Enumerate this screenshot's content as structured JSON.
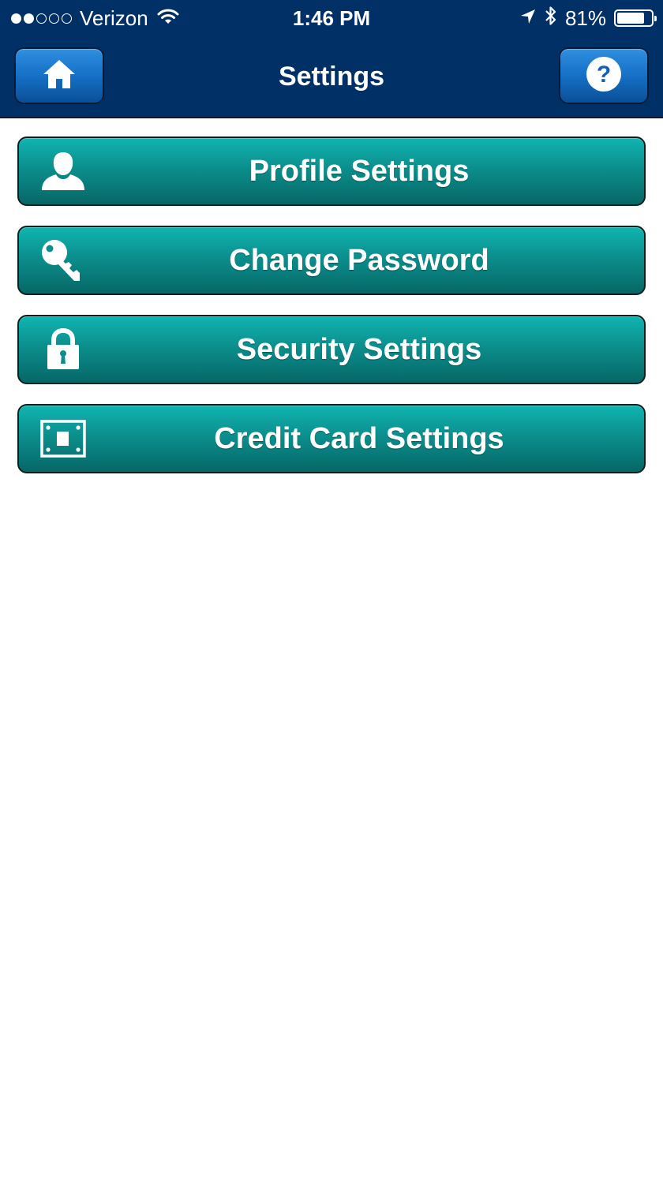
{
  "status_bar": {
    "carrier": "Verizon",
    "time": "1:46 PM",
    "battery": "81%",
    "battery_level": 0.81,
    "signal_bars_filled": 2,
    "signal_bars_total": 5
  },
  "header": {
    "title": "Settings",
    "left_icon": "home-icon",
    "right_icon": "help-icon"
  },
  "menu": {
    "items": [
      {
        "label": "Profile Settings",
        "icon": "user-icon"
      },
      {
        "label": "Change Password",
        "icon": "key-icon"
      },
      {
        "label": "Security Settings",
        "icon": "lock-icon"
      },
      {
        "label": "Credit Card Settings",
        "icon": "credit-card-icon"
      }
    ]
  },
  "colors": {
    "header_bg": "#003066",
    "nav_button": "#1570c6",
    "menu_button": "#0b8f8d",
    "text": "#ffffff"
  }
}
